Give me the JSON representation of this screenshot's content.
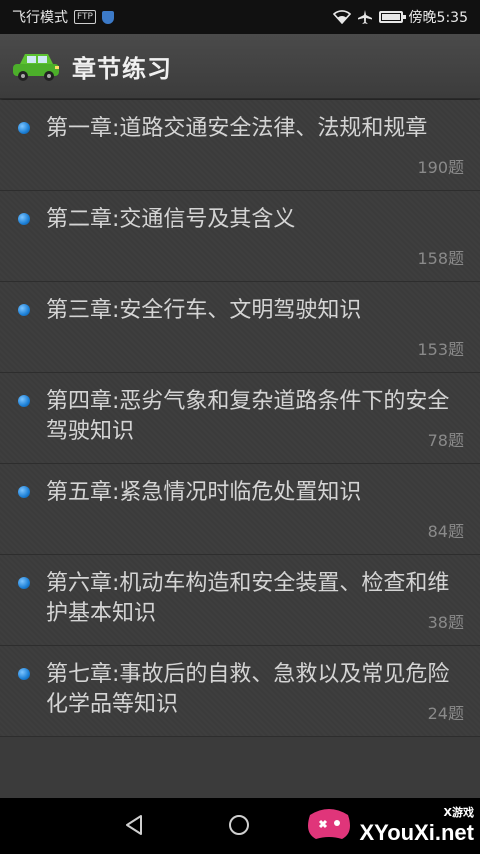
{
  "status_bar": {
    "left_text": "飞行模式",
    "badge": "FTP",
    "time": "傍晚5:35",
    "icons": [
      "ftp-icon",
      "shield-icon",
      "wifi-icon",
      "airplane-icon",
      "battery-icon"
    ]
  },
  "header": {
    "title": "章节练习",
    "icon": "car-icon"
  },
  "chapters": [
    {
      "title": "第一章:道路交通安全法律、法规和规章",
      "count": "190题"
    },
    {
      "title": "第二章:交通信号及其含义",
      "count": "158题"
    },
    {
      "title": "第三章:安全行车、文明驾驶知识",
      "count": "153题"
    },
    {
      "title": "第四章:恶劣气象和复杂道路条件下的安全驾驶知识",
      "count": "78题"
    },
    {
      "title": "第五章:紧急情况时临危处置知识",
      "count": "84题"
    },
    {
      "title": "第六章:机动车构造和安全装置、检查和维护基本知识",
      "count": "38题"
    },
    {
      "title": "第七章:事故后的自救、急救以及常见危险化学品等知识",
      "count": "24题"
    }
  ],
  "nav": {
    "icons": [
      "back-icon",
      "home-icon"
    ]
  },
  "watermark": {
    "small": "X游戏",
    "big": "XYouXi.net"
  },
  "colors": {
    "background": "#3b3b3b",
    "bullet": "#1b7fd6",
    "status_bar": "#111111"
  }
}
